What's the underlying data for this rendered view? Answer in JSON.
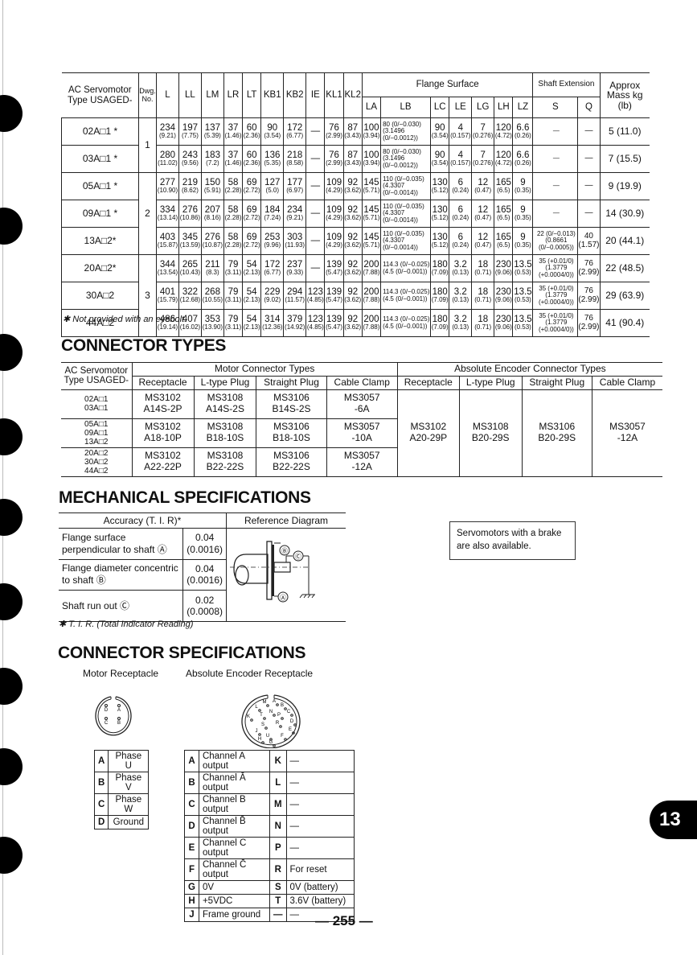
{
  "dimensions_table": {
    "headers": {
      "type": "AC Servomotor Type USAGED-",
      "dwg": "Dwg. No.",
      "cols": [
        "L",
        "LL",
        "LM",
        "LR",
        "LT",
        "KB1",
        "KB2",
        "IE",
        "KL1",
        "KL2"
      ],
      "flange_group": "Flange Surface",
      "flange_cols": [
        "LA",
        "LB",
        "LC",
        "LE",
        "LG",
        "LH",
        "LZ"
      ],
      "shaft_group": "Shaft Extension",
      "shaft_cols": [
        "S",
        "Q"
      ],
      "mass": "Approx Mass kg (lb)"
    },
    "dwg_groups": [
      {
        "no": "1",
        "rows": 2
      },
      {
        "no": "2",
        "rows": 3
      },
      {
        "no": "3",
        "rows": 3
      }
    ],
    "rows": [
      {
        "type": "02A□1 *",
        "L": [
          "234",
          "(9.21)"
        ],
        "LL": [
          "197",
          "(7.75)"
        ],
        "LM": [
          "137",
          "(5.39)"
        ],
        "LR": [
          "37",
          "(1.46)"
        ],
        "LT": [
          "60",
          "(2.36)"
        ],
        "KB1": [
          "90",
          "(3.54)"
        ],
        "KB2": [
          "172",
          "(6.77)"
        ],
        "IE": [
          "—",
          ""
        ],
        "KL1": [
          "76",
          "(2.99)"
        ],
        "KL2": [
          "87",
          "(3.43)"
        ],
        "LA": [
          "100",
          "(3.94)"
        ],
        "LB": "80 (0/−0.030) (3.1496 (0/−0.0012))",
        "LC": [
          "90",
          "(3.54)"
        ],
        "LE": [
          "4",
          "(0.157)"
        ],
        "LG": [
          "7",
          "(0.276)"
        ],
        "LH": [
          "120",
          "(4.72)"
        ],
        "LZ": [
          "6.6",
          "(0.26)"
        ],
        "S": "—",
        "Q": "—",
        "mass": "5 (11.0)"
      },
      {
        "type": "03A□1 *",
        "L": [
          "280",
          "(11.02)"
        ],
        "LL": [
          "243",
          "(9.56)"
        ],
        "LM": [
          "183",
          "(7.2)"
        ],
        "LR": [
          "37",
          "(1.46)"
        ],
        "LT": [
          "60",
          "(2.36)"
        ],
        "KB1": [
          "136",
          "(5.35)"
        ],
        "KB2": [
          "218",
          "(8.58)"
        ],
        "IE": [
          "—",
          ""
        ],
        "KL1": [
          "76",
          "(2.99)"
        ],
        "KL2": [
          "87",
          "(3.43)"
        ],
        "LA": [
          "100",
          "(3.94)"
        ],
        "LB": "80 (0/−0.030) (3.1496 (0/−0.0012))",
        "LC": [
          "90",
          "(3.54)"
        ],
        "LE": [
          "4",
          "(0.157)"
        ],
        "LG": [
          "7",
          "(0.276)"
        ],
        "LH": [
          "120",
          "(4.72)"
        ],
        "LZ": [
          "6.6",
          "(0.26)"
        ],
        "S": "—",
        "Q": "—",
        "mass": "7 (15.5)"
      },
      {
        "type": "05A□1 *",
        "L": [
          "277",
          "(10.90)"
        ],
        "LL": [
          "219",
          "(8.62)"
        ],
        "LM": [
          "150",
          "(5.91)"
        ],
        "LR": [
          "58",
          "(2.28)"
        ],
        "LT": [
          "69",
          "(2.72)"
        ],
        "KB1": [
          "127",
          "(5.0)"
        ],
        "KB2": [
          "177",
          "(6.97)"
        ],
        "IE": [
          "—",
          ""
        ],
        "KL1": [
          "109",
          "(4.29)"
        ],
        "KL2": [
          "92",
          "(3.62)"
        ],
        "LA": [
          "145",
          "(5.71)"
        ],
        "LB": "110 (0/−0.035) (4.3307 (0/−0.0014))",
        "LC": [
          "130",
          "(5.12)"
        ],
        "LE": [
          "6",
          "(0.24)"
        ],
        "LG": [
          "12",
          "(0.47)"
        ],
        "LH": [
          "165",
          "(6.5)"
        ],
        "LZ": [
          "9",
          "(0.35)"
        ],
        "S": "—",
        "Q": "—",
        "mass": "9 (19.9)"
      },
      {
        "type": "09A□1 *",
        "L": [
          "334",
          "(13.14)"
        ],
        "LL": [
          "276",
          "(10.86)"
        ],
        "LM": [
          "207",
          "(8.16)"
        ],
        "LR": [
          "58",
          "(2.28)"
        ],
        "LT": [
          "69",
          "(2.72)"
        ],
        "KB1": [
          "184",
          "(7.24)"
        ],
        "KB2": [
          "234",
          "(9.21)"
        ],
        "IE": [
          "—",
          ""
        ],
        "KL1": [
          "109",
          "(4.29)"
        ],
        "KL2": [
          "92",
          "(3.62)"
        ],
        "LA": [
          "145",
          "(5.71)"
        ],
        "LB": "110 (0/−0.035) (4.3307 (0/−0.0014))",
        "LC": [
          "130",
          "(5.12)"
        ],
        "LE": [
          "6",
          "(0.24)"
        ],
        "LG": [
          "12",
          "(0.47)"
        ],
        "LH": [
          "165",
          "(6.5)"
        ],
        "LZ": [
          "9",
          "(0.35)"
        ],
        "S": "—",
        "Q": "—",
        "mass": "14 (30.9)"
      },
      {
        "type": "13A□2*",
        "L": [
          "403",
          "(15.87)"
        ],
        "LL": [
          "345",
          "(13.59)"
        ],
        "LM": [
          "276",
          "(10.87)"
        ],
        "LR": [
          "58",
          "(2.28)"
        ],
        "LT": [
          "69",
          "(2.72)"
        ],
        "KB1": [
          "253",
          "(9.96)"
        ],
        "KB2": [
          "303",
          "(11.93)"
        ],
        "IE": [
          "—",
          ""
        ],
        "KL1": [
          "109",
          "(4.29)"
        ],
        "KL2": [
          "92",
          "(3.62)"
        ],
        "LA": [
          "145",
          "(5.71)"
        ],
        "LB": "110 (0/−0.035) (4.3307 (0/−0.0014))",
        "LC": [
          "130",
          "(5.12)"
        ],
        "LE": [
          "6",
          "(0.24)"
        ],
        "LG": [
          "12",
          "(0.47)"
        ],
        "LH": [
          "165",
          "(6.5)"
        ],
        "LZ": [
          "9",
          "(0.35)"
        ],
        "S": "22 (0/−0.013) (0.8661 (0/−0.0005))",
        "Q": "40 (1.57)",
        "mass": "20 (44.1)"
      },
      {
        "type": "20A□2*",
        "L": [
          "344",
          "(13.54)"
        ],
        "LL": [
          "265",
          "(10.43)"
        ],
        "LM": [
          "211",
          "(8.3)"
        ],
        "LR": [
          "79",
          "(3.11)"
        ],
        "LT": [
          "54",
          "(2.13)"
        ],
        "KB1": [
          "172",
          "(6.77)"
        ],
        "KB2": [
          "237",
          "(9.33)"
        ],
        "IE": [
          "—",
          ""
        ],
        "KL1": [
          "139",
          "(5.47)"
        ],
        "KL2": [
          "92",
          "(3.62)"
        ],
        "LA": [
          "200",
          "(7.88)"
        ],
        "LB": "114.3 (0/−0.025) (4.5 (0/−0.001))",
        "LC": [
          "180",
          "(7.09)"
        ],
        "LE": [
          "3.2",
          "(0.13)"
        ],
        "LG": [
          "18",
          "(0.71)"
        ],
        "LH": [
          "230",
          "(9.06)"
        ],
        "LZ": [
          "13.5",
          "(0.53)"
        ],
        "S": "35 (+0.01/0) (1.3779 (+0.0004/0))",
        "Q": "76 (2.99)",
        "mass": "22 (48.5)"
      },
      {
        "type": "30A□2",
        "L": [
          "401",
          "(15.79)"
        ],
        "LL": [
          "322",
          "(12.68)"
        ],
        "LM": [
          "268",
          "(10.55)"
        ],
        "LR": [
          "79",
          "(3.11)"
        ],
        "LT": [
          "54",
          "(2.13)"
        ],
        "KB1": [
          "229",
          "(9.02)"
        ],
        "KB2": [
          "294",
          "(11.57)"
        ],
        "IE": [
          "123",
          "(4.85)"
        ],
        "KL1": [
          "139",
          "(5.47)"
        ],
        "KL2": [
          "92",
          "(3.62)"
        ],
        "LA": [
          "200",
          "(7.88)"
        ],
        "LB": "114.3 (0/−0.025) (4.5 (0/−0.001))",
        "LC": [
          "180",
          "(7.09)"
        ],
        "LE": [
          "3.2",
          "(0.13)"
        ],
        "LG": [
          "18",
          "(0.71)"
        ],
        "LH": [
          "230",
          "(9.06)"
        ],
        "LZ": [
          "13.5",
          "(0.53)"
        ],
        "S": "35 (+0.01/0) (1.3779 (+0.0004/0))",
        "Q": "76 (2.99)",
        "mass": "29 (63.9)"
      },
      {
        "type": "44A□2",
        "L": [
          "486",
          "(19.14)"
        ],
        "LL": [
          "407",
          "(16.02)"
        ],
        "LM": [
          "353",
          "(13.90)"
        ],
        "LR": [
          "79",
          "(3.11)"
        ],
        "LT": [
          "54",
          "(2.13)"
        ],
        "KB1": [
          "314",
          "(12.36)"
        ],
        "KB2": [
          "379",
          "(14.92)"
        ],
        "IE": [
          "123",
          "(4.85)"
        ],
        "KL1": [
          "139",
          "(5.47)"
        ],
        "KL2": [
          "92",
          "(3.62)"
        ],
        "LA": [
          "200",
          "(7.88)"
        ],
        "LB": "114.3 (0/−0.025) (4.5 (0/−0.001))",
        "LC": [
          "180",
          "(7.09)"
        ],
        "LE": [
          "3.2",
          "(0.13)"
        ],
        "LG": [
          "18",
          "(0.71)"
        ],
        "LH": [
          "230",
          "(9.06)"
        ],
        "LZ": [
          "13.5",
          "(0.53)"
        ],
        "S": "35 (+0.01/0) (1.3779 (+0.0004/0))",
        "Q": "76 (2.99)",
        "mass": "41 (90.4)"
      }
    ],
    "footnote": "✱ Not provided with an eyebolt."
  },
  "connector_types": {
    "title": "CONNECTOR TYPES",
    "type_header": "AC Servomotor Type USAGED-",
    "motor_group": "Motor Connector Types",
    "encoder_group": "Absolute Encoder Connector Types",
    "cols": [
      "Receptacle",
      "L-type Plug",
      "Straight Plug",
      "Cable Clamp"
    ],
    "motor_rows": [
      {
        "types": [
          "02A□1",
          "03A□1"
        ],
        "receptacle": [
          "MS3102",
          "A14S-2P"
        ],
        "ltype": [
          "MS3108",
          "A14S-2S"
        ],
        "straight": [
          "MS3106",
          "B14S-2S"
        ],
        "clamp": [
          "MS3057",
          "-6A"
        ]
      },
      {
        "types": [
          "05A□1",
          "09A□1",
          "13A□2"
        ],
        "receptacle": [
          "MS3102",
          "A18-10P"
        ],
        "ltype": [
          "MS3108",
          "B18-10S"
        ],
        "straight": [
          "MS3106",
          "B18-10S"
        ],
        "clamp": [
          "MS3057",
          "-10A"
        ]
      },
      {
        "types": [
          "20A□2",
          "30A□2",
          "44A□2"
        ],
        "receptacle": [
          "MS3102",
          "A22-22P"
        ],
        "ltype": [
          "MS3108",
          "B22-22S"
        ],
        "straight": [
          "MS3106",
          "B22-22S"
        ],
        "clamp": [
          "MS3057",
          "-12A"
        ]
      }
    ],
    "encoder": {
      "receptacle": [
        "MS3102",
        "A20-29P"
      ],
      "ltype": [
        "MS3108",
        "B20-29S"
      ],
      "straight": [
        "MS3106",
        "B20-29S"
      ],
      "clamp": [
        "MS3057",
        "-12A"
      ]
    }
  },
  "mechanical": {
    "title": "MECHANICAL SPECIFICATIONS",
    "accuracy_header": "Accuracy (T. I. R)*",
    "diagram_header": "Reference Diagram",
    "rows": [
      {
        "label": "Flange surface perpendicular to shaft Ⓐ",
        "value": "0.04",
        "inch": "(0.0016)"
      },
      {
        "label": "Flange diameter concentric to shaft Ⓑ",
        "value": "0.04",
        "inch": "(0.0016)"
      },
      {
        "label": "Shaft run out Ⓒ",
        "value": "0.02",
        "inch": "(0.0008)"
      }
    ],
    "diagram_labels": [
      "Ⓑ",
      "Ⓒ",
      "Ⓐ"
    ],
    "footnote": "✱ T. I. R. (Total Indicator Reading)",
    "note": "Servomotors with a brake are also available."
  },
  "connector_specs": {
    "title": "CONNECTOR SPECIFICATIONS",
    "motor_label": "Motor Receptacle",
    "encoder_label": "Absolute Encoder Receptacle",
    "motor_face_pins": [
      "D",
      "A",
      "C",
      "B"
    ],
    "encoder_face_pins": [
      "M",
      "A",
      "B",
      "L",
      "N",
      "C",
      "K",
      "T",
      "P",
      "D",
      "S",
      "R",
      "E",
      "J",
      "U",
      "F",
      "H",
      "G"
    ],
    "motor_pins": [
      {
        "pin": "A",
        "signal": "Phase U"
      },
      {
        "pin": "B",
        "signal": "Phase V"
      },
      {
        "pin": "C",
        "signal": "Phase W"
      },
      {
        "pin": "D",
        "signal": "Ground"
      }
    ],
    "encoder_pins": [
      {
        "pin": "A",
        "signal": "Channel A output",
        "pin2": "K",
        "signal2": "—"
      },
      {
        "pin": "B",
        "signal": "Channel Ā output",
        "pin2": "L",
        "signal2": "—"
      },
      {
        "pin": "C",
        "signal": "Channel B output",
        "pin2": "M",
        "signal2": "—"
      },
      {
        "pin": "D",
        "signal": "Channel B̄ output",
        "pin2": "N",
        "signal2": "—"
      },
      {
        "pin": "E",
        "signal": "Channel C output",
        "pin2": "P",
        "signal2": "—"
      },
      {
        "pin": "F",
        "signal": "Channel C̄ output",
        "pin2": "R",
        "signal2": "For reset"
      },
      {
        "pin": "G",
        "signal": "0V",
        "pin2": "S",
        "signal2": "0V (battery)"
      },
      {
        "pin": "H",
        "signal": "+5VDC",
        "pin2": "T",
        "signal2": "3.6V (battery)"
      },
      {
        "pin": "J",
        "signal": "Frame ground",
        "pin2": "—",
        "signal2": "—"
      }
    ]
  },
  "chapter_tab": "13",
  "page_number": "— 255 —"
}
